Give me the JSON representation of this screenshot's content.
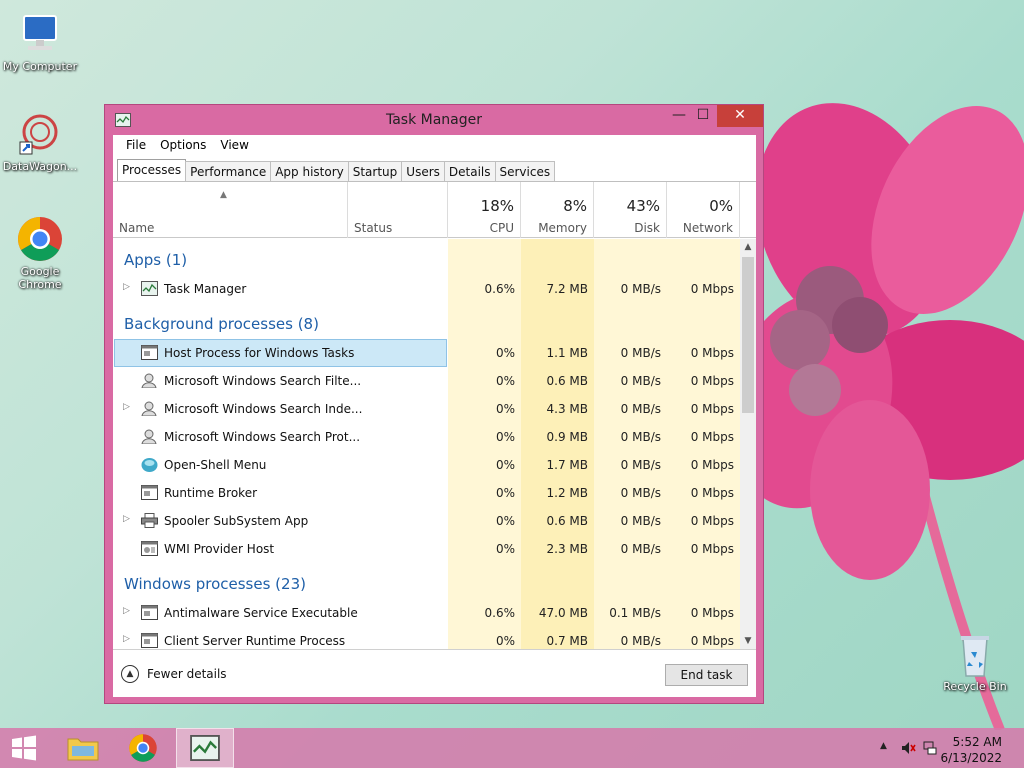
{
  "desktop": {
    "icons": [
      {
        "label": "My Computer"
      },
      {
        "label": "DataWagon..."
      },
      {
        "label": "Google Chrome"
      },
      {
        "label": "Recycle Bin"
      }
    ]
  },
  "window": {
    "title": "Task Manager",
    "min_symbol": "—",
    "max_symbol": "☐",
    "close_symbol": "✕"
  },
  "menu": [
    "File",
    "Options",
    "View"
  ],
  "tabs": [
    "Processes",
    "Performance",
    "App history",
    "Startup",
    "Users",
    "Details",
    "Services"
  ],
  "active_tab": "Processes",
  "columns": {
    "name": "Name",
    "status": "Status",
    "cpu": {
      "pct": "18%",
      "label": "CPU"
    },
    "memory": {
      "pct": "8%",
      "label": "Memory"
    },
    "disk": {
      "pct": "43%",
      "label": "Disk"
    },
    "network": {
      "pct": "0%",
      "label": "Network"
    }
  },
  "groups": [
    {
      "title": "Apps (1)",
      "rows": [
        {
          "name": "Task Manager",
          "cpu": "0.6%",
          "memory": "7.2 MB",
          "disk": "0 MB/s",
          "network": "0 Mbps",
          "expandable": true,
          "icon": "taskmgr-icon"
        }
      ]
    },
    {
      "title": "Background processes (8)",
      "rows": [
        {
          "name": "Host Process for Windows Tasks",
          "cpu": "0%",
          "memory": "1.1 MB",
          "disk": "0 MB/s",
          "network": "0 Mbps",
          "expandable": false,
          "icon": "window-icon",
          "selected": true
        },
        {
          "name": "Microsoft Windows Search Filte...",
          "cpu": "0%",
          "memory": "0.6 MB",
          "disk": "0 MB/s",
          "network": "0 Mbps",
          "expandable": false,
          "icon": "search-user-icon"
        },
        {
          "name": "Microsoft Windows Search Inde...",
          "cpu": "0%",
          "memory": "4.3 MB",
          "disk": "0 MB/s",
          "network": "0 Mbps",
          "expandable": true,
          "icon": "search-user-icon"
        },
        {
          "name": "Microsoft Windows Search Prot...",
          "cpu": "0%",
          "memory": "0.9 MB",
          "disk": "0 MB/s",
          "network": "0 Mbps",
          "expandable": false,
          "icon": "search-user-icon"
        },
        {
          "name": "Open-Shell Menu",
          "cpu": "0%",
          "memory": "1.7 MB",
          "disk": "0 MB/s",
          "network": "0 Mbps",
          "expandable": false,
          "icon": "shell-icon"
        },
        {
          "name": "Runtime Broker",
          "cpu": "0%",
          "memory": "1.2 MB",
          "disk": "0 MB/s",
          "network": "0 Mbps",
          "expandable": false,
          "icon": "window-icon"
        },
        {
          "name": "Spooler SubSystem App",
          "cpu": "0%",
          "memory": "0.6 MB",
          "disk": "0 MB/s",
          "network": "0 Mbps",
          "expandable": true,
          "icon": "printer-icon"
        },
        {
          "name": "WMI Provider Host",
          "cpu": "0%",
          "memory": "2.3 MB",
          "disk": "0 MB/s",
          "network": "0 Mbps",
          "expandable": false,
          "icon": "wmi-icon"
        }
      ]
    },
    {
      "title": "Windows processes (23)",
      "rows": [
        {
          "name": "Antimalware Service Executable",
          "cpu": "0.6%",
          "memory": "47.0 MB",
          "disk": "0.1 MB/s",
          "network": "0 Mbps",
          "expandable": true,
          "icon": "window-icon"
        },
        {
          "name": "Client Server Runtime Process",
          "cpu": "0%",
          "memory": "0.7 MB",
          "disk": "0 MB/s",
          "network": "0 Mbps",
          "expandable": true,
          "icon": "window-icon"
        }
      ]
    }
  ],
  "footer": {
    "fewer_details": "Fewer details",
    "end_task": "End task"
  },
  "taskbar": {
    "time": "5:52 AM",
    "date": "6/13/2022"
  },
  "colors": {
    "titlebar": "#d96aa3",
    "close": "#c7403a",
    "group_title": "#1f5fa8",
    "heat_light": "#fff7d6",
    "heat_mid": "#fdf0b8",
    "selected": "#cce8f7"
  }
}
